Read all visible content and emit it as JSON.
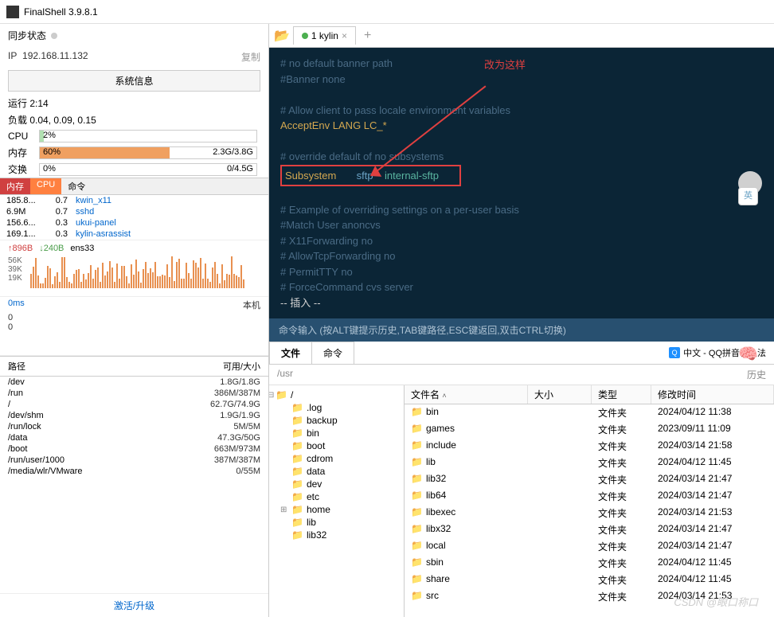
{
  "app": {
    "title": "FinalShell 3.9.8.1"
  },
  "sync": {
    "label": "同步状态"
  },
  "ip": {
    "label": "IP",
    "value": "192.168.11.132",
    "copy": "复制"
  },
  "sysinfo_btn": "系统信息",
  "stats": {
    "uptime_label": "运行",
    "uptime": "2:14",
    "load_label": "负载",
    "load": "0.04, 0.09, 0.15",
    "cpu_label": "CPU",
    "cpu_pct": "2%",
    "mem_label": "内存",
    "mem_pct": "60%",
    "mem_text": "2.3G/3.8G",
    "swap_label": "交换",
    "swap_pct": "0%",
    "swap_text": "0/4.5G"
  },
  "proc_headers": {
    "mem": "内存",
    "cpu": "CPU",
    "cmd": "命令"
  },
  "procs": [
    {
      "mem": "185.8...",
      "cpu": "0.7",
      "cmd": "kwin_x11"
    },
    {
      "mem": "6.9M",
      "cpu": "0.7",
      "cmd": "sshd"
    },
    {
      "mem": "156.6...",
      "cpu": "0.3",
      "cmd": "ukui-panel"
    },
    {
      "mem": "169.1...",
      "cpu": "0.3",
      "cmd": "kylin-asrassist"
    }
  ],
  "net": {
    "up": "↑896B",
    "down": "↓240B",
    "iface": "ens33"
  },
  "chart_y": [
    "56K",
    "39K",
    "19K"
  ],
  "ms": {
    "value": "0ms",
    "host": "本机",
    "z1": "0",
    "z2": "0"
  },
  "path_header": {
    "path": "路径",
    "size": "可用/大小"
  },
  "paths": [
    {
      "p": "/dev",
      "s": "1.8G/1.8G"
    },
    {
      "p": "/run",
      "s": "386M/387M"
    },
    {
      "p": "/",
      "s": "62.7G/74.9G"
    },
    {
      "p": "/dev/shm",
      "s": "1.9G/1.9G"
    },
    {
      "p": "/run/lock",
      "s": "5M/5M"
    },
    {
      "p": "/data",
      "s": "47.3G/50G"
    },
    {
      "p": "/boot",
      "s": "663M/973M"
    },
    {
      "p": "/run/user/1000",
      "s": "387M/387M"
    },
    {
      "p": "/media/wlr/VMware",
      "s": "0/55M"
    }
  ],
  "activate": "激活/升级",
  "tab": {
    "name": "1 kylin"
  },
  "terminal": {
    "annotation": "改为这样",
    "lines": [
      {
        "t": "comment",
        "text": "# no default banner path"
      },
      {
        "t": "comment",
        "text": "#Banner none"
      },
      {
        "t": "blank",
        "text": ""
      },
      {
        "t": "comment",
        "text": "# Allow client to pass locale environment variables"
      },
      {
        "t": "kv",
        "k": "AcceptEnv",
        "v": "LANG LC_*"
      },
      {
        "t": "blank",
        "text": ""
      },
      {
        "t": "comment",
        "text": "# override default of no subsystems"
      },
      {
        "t": "boxed",
        "k": "Subsystem",
        "m": "sftp",
        "v": "internal-sftp"
      },
      {
        "t": "blank",
        "text": ""
      },
      {
        "t": "comment",
        "text": "# Example of overriding settings on a per-user basis"
      },
      {
        "t": "comment",
        "text": "#Match User anoncvs"
      },
      {
        "t": "comment",
        "text": "#       X11Forwarding no"
      },
      {
        "t": "comment",
        "text": "#       AllowTcpForwarding no"
      },
      {
        "t": "comment",
        "text": "#       PermitTTY no"
      },
      {
        "t": "comment",
        "text": "#       ForceCommand cvs server"
      },
      {
        "t": "status",
        "text": "-- 插入 --"
      }
    ],
    "input_hint": "命令输入 (按ALT键提示历史,TAB键路径,ESC键返回,双击CTRL切换)"
  },
  "ime": {
    "text": "中文 - QQ拼音输入法"
  },
  "lang_badge": "英",
  "file_tabs": {
    "files": "文件",
    "cmd": "命令"
  },
  "path_bar": {
    "path": "/usr",
    "history": "历史"
  },
  "tree": [
    {
      "name": ".log"
    },
    {
      "name": "backup"
    },
    {
      "name": "bin"
    },
    {
      "name": "boot"
    },
    {
      "name": "cdrom"
    },
    {
      "name": "data"
    },
    {
      "name": "dev"
    },
    {
      "name": "etc"
    },
    {
      "name": "home",
      "expandable": true
    },
    {
      "name": "lib"
    },
    {
      "name": "lib32"
    }
  ],
  "tree_root": "/",
  "list_headers": {
    "name": "文件名",
    "size": "大小",
    "type": "类型",
    "date": "修改时间"
  },
  "files": [
    {
      "n": "bin",
      "t": "文件夹",
      "d": "2024/04/12 11:38"
    },
    {
      "n": "games",
      "t": "文件夹",
      "d": "2023/09/11 11:09"
    },
    {
      "n": "include",
      "t": "文件夹",
      "d": "2024/03/14 21:58"
    },
    {
      "n": "lib",
      "t": "文件夹",
      "d": "2024/04/12 11:45"
    },
    {
      "n": "lib32",
      "t": "文件夹",
      "d": "2024/03/14 21:47"
    },
    {
      "n": "lib64",
      "t": "文件夹",
      "d": "2024/03/14 21:47"
    },
    {
      "n": "libexec",
      "t": "文件夹",
      "d": "2024/03/14 21:53"
    },
    {
      "n": "libx32",
      "t": "文件夹",
      "d": "2024/03/14 21:47"
    },
    {
      "n": "local",
      "t": "文件夹",
      "d": "2024/03/14 21:47"
    },
    {
      "n": "sbin",
      "t": "文件夹",
      "d": "2024/04/12 11:45"
    },
    {
      "n": "share",
      "t": "文件夹",
      "d": "2024/04/12 11:45"
    },
    {
      "n": "src",
      "t": "文件夹",
      "d": "2024/03/14 21:53"
    }
  ],
  "watermark": "CSDN @眼口称口"
}
